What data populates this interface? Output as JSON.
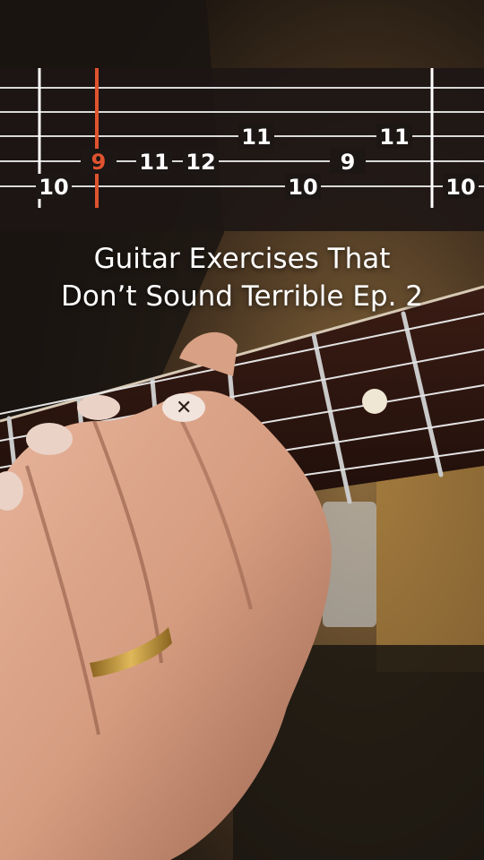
{
  "tablature": {
    "notes": [
      {
        "fret": "10",
        "string": 5
      },
      {
        "fret": "9",
        "string": 4,
        "active": true
      },
      {
        "fret": "11",
        "string": 4
      },
      {
        "fret": "12",
        "string": 4
      },
      {
        "fret": "11",
        "string": 3
      },
      {
        "fret": "10",
        "string": 5
      },
      {
        "fret": "9",
        "string": 4
      },
      {
        "fret": "11",
        "string": 3
      },
      {
        "fret": "10",
        "string": 5
      }
    ],
    "cursor_color": "#e0532f",
    "line_color": "#d9d9d9"
  },
  "caption": {
    "line1": "Guitar Exercises That",
    "line2": "Don’t Sound Terrible Ep. 2"
  }
}
